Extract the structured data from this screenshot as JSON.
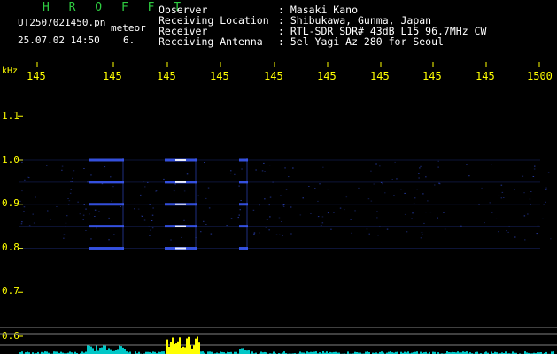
{
  "header": {
    "title": "H R O F F T",
    "filename": "UT2507021450.pn",
    "mode": "meteor",
    "date": "25.07.02 14:50",
    "number": "6."
  },
  "info": [
    {
      "label": "Observer",
      "value": ": Masaki Kano"
    },
    {
      "label": "Receiving Location",
      "value": ": Shibukawa, Gunma, Japan"
    },
    {
      "label": "Receiver",
      "value": ": RTL-SDR SDR# 43dB L15 96.7MHz CW"
    },
    {
      "label": "Receiving Antenna",
      "value": ": 5el Yagi Az 280 for Seoul"
    }
  ],
  "chart_data": {
    "type": "heatmap",
    "ylabel": "kHz",
    "x_tick_labels": [
      "145",
      "145",
      "145",
      "145",
      "145",
      "145",
      "145",
      "145",
      "145",
      "1500"
    ],
    "y_ticks": [
      1.1,
      1.0,
      0.9,
      0.8,
      0.7,
      0.6
    ],
    "y_tick_labels": [
      "1.1",
      "1.0",
      "0.9",
      "0.8",
      "0.7",
      "0.6"
    ],
    "ylim": [
      0.58,
      1.2
    ],
    "echo_frequencies": [
      1.0,
      0.95,
      0.9,
      0.85,
      0.8
    ],
    "colors": {
      "background": "#000000",
      "axis_text": "#ffff00",
      "grid": "#808080",
      "signal": "#3c5cff",
      "signal_peak": "#ffffff",
      "histogram": "#00c8c8",
      "histogram_peak": "#ffff00"
    }
  }
}
